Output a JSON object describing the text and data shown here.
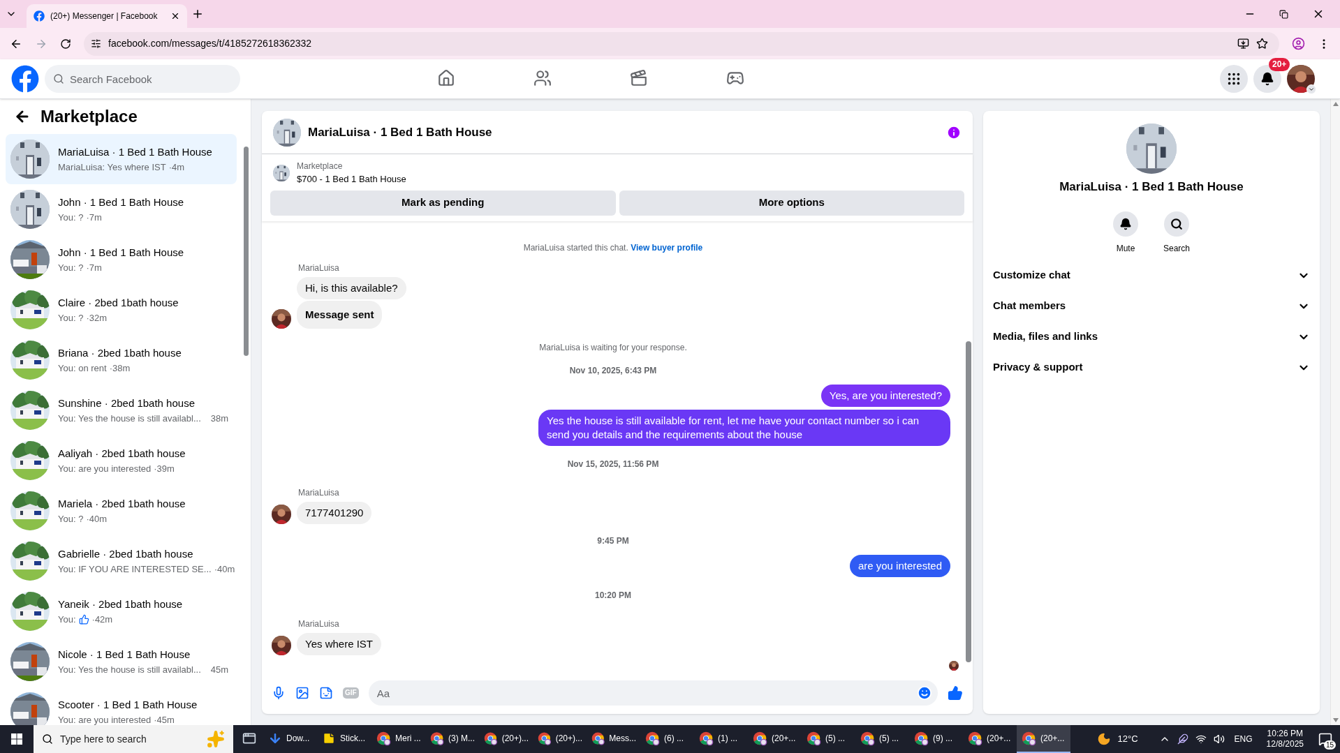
{
  "browser": {
    "tab_title": "(20+) Messenger | Facebook",
    "url": "facebook.com/messages/t/4185272618362332"
  },
  "header": {
    "search_placeholder": "Search Facebook",
    "nav": [
      {
        "kind": "home",
        "selected": false
      },
      {
        "kind": "friends",
        "selected": false
      },
      {
        "kind": "video",
        "selected": false
      },
      {
        "kind": "gaming",
        "selected": false
      }
    ],
    "notification_badge": "20+"
  },
  "sidebar": {
    "title": "Marketplace",
    "conversations": [
      {
        "title": "MariaLuisa · 1 Bed 1 Bath House",
        "kind": "text",
        "preview": "MariaLuisa: Yes where IST",
        "time": "·4m",
        "selected": true
      },
      {
        "title": "John · 1 Bed 1 Bath House",
        "kind": "text",
        "preview": "You: ?",
        "time": "·7m",
        "selected": false
      },
      {
        "title": "John · 1 Bed 1 Bath House",
        "kind": "text",
        "preview": "You: ?",
        "time": "·7m",
        "selected": false
      },
      {
        "title": "Claire · 2bed 1bath house",
        "kind": "text",
        "preview": "You: ?",
        "time": "·32m",
        "selected": false
      },
      {
        "title": "Briana · 2bed 1bath house",
        "kind": "text",
        "preview": "You: on rent",
        "time": "·38m",
        "selected": false
      },
      {
        "title": "Sunshine · 2bed 1bath house",
        "kind": "text",
        "preview": "You: Yes the house is still availabl...",
        "time": "38m",
        "selected": false
      },
      {
        "title": "Aaliyah · 2bed 1bath house",
        "kind": "text",
        "preview": "You: are you interested",
        "time": "·39m",
        "selected": false
      },
      {
        "title": "Mariela · 2bed 1bath house",
        "kind": "text",
        "preview": "You: ?",
        "time": "·40m",
        "selected": false
      },
      {
        "title": "Gabrielle · 2bed 1bath house",
        "kind": "text",
        "preview": "You: IF YOU ARE INTERESTED SE...",
        "time": "·40m",
        "selected": false
      },
      {
        "title": "Yaneik · 2bed 1bath house",
        "kind": "like",
        "preview": "You:",
        "time": "·42m",
        "selected": false
      },
      {
        "title": "Nicole · 1 Bed 1 Bath House",
        "kind": "text",
        "preview": "You: Yes the house is still availabl...",
        "time": "45m",
        "selected": false
      },
      {
        "title": "Scooter · 1 Bed 1 Bath House",
        "kind": "text",
        "preview": "You: are you interested",
        "time": "·45m",
        "selected": false
      }
    ]
  },
  "chat": {
    "title": "MariaLuisa · 1 Bed 1 Bath House",
    "listing": {
      "label": "Marketplace",
      "price_title": "$700 - 1 Bed 1 Bath House"
    },
    "actions": [
      "Mark as pending",
      "More options"
    ],
    "messages": [
      {
        "kind": "system",
        "text": "MariaLuisa started this chat.",
        "link": "View buyer profile"
      },
      {
        "kind": "sender",
        "text": "MariaLuisa"
      },
      {
        "kind": "incoming",
        "text": "Hi, is this available?",
        "avatar": false,
        "bold": false
      },
      {
        "kind": "incoming",
        "text": "Message sent",
        "avatar": true,
        "bold": true
      },
      {
        "kind": "notice",
        "text": "MariaLuisa is waiting for your response."
      },
      {
        "kind": "timestamp",
        "text": "Nov 10, 2025, 6:43 PM"
      },
      {
        "kind": "outgoing",
        "text": "Yes, are you interested?",
        "color": "#7a34f6"
      },
      {
        "kind": "outgoing",
        "text": "Yes the house is still available for rent, let me have your contact number so i can send you details and the requirements about the house",
        "color": "#6a38f5"
      },
      {
        "kind": "timestamp",
        "text": "Nov 15, 2025, 11:56 PM"
      },
      {
        "kind": "sender",
        "text": "MariaLuisa"
      },
      {
        "kind": "incoming",
        "text": "7177401290",
        "avatar": true,
        "bold": false
      },
      {
        "kind": "timestamp",
        "text": "9:45 PM"
      },
      {
        "kind": "outgoing",
        "text": "are you interested",
        "color": "#2f5bf4"
      },
      {
        "kind": "timestamp",
        "text": "10:20 PM"
      },
      {
        "kind": "sender",
        "text": "MariaLuisa"
      },
      {
        "kind": "incoming",
        "text": "Yes where IST",
        "avatar": true,
        "bold": false
      },
      {
        "kind": "read_receipt"
      }
    ],
    "composer": {
      "gif_label": "GIF",
      "placeholder": "Aa"
    }
  },
  "details": {
    "title": "MariaLuisa · 1 Bed 1 Bath House",
    "actions": [
      {
        "kind": "mute",
        "label": "Mute"
      },
      {
        "kind": "search",
        "label": "Search"
      }
    ],
    "sections": [
      {
        "label": "Customize chat",
        "expanded": false
      },
      {
        "label": "Chat members",
        "expanded": false
      },
      {
        "label": "Media, files and links",
        "expanded": false
      },
      {
        "label": "Privacy & support",
        "expanded": false
      }
    ]
  },
  "taskbar": {
    "search_placeholder": "Type here to search",
    "apps": [
      {
        "kind": "window",
        "selected": false
      },
      {
        "kind": "download",
        "label": "Dow...",
        "selected": false
      },
      {
        "kind": "note",
        "label": "Stick...",
        "selected": false
      },
      {
        "kind": "browser",
        "label": "Meri ...",
        "selected": false
      },
      {
        "kind": "browser",
        "label": "(3) M...",
        "selected": false
      },
      {
        "kind": "browser",
        "label": "(20+)...",
        "selected": false
      },
      {
        "kind": "browser",
        "label": "(20+)...",
        "selected": false
      },
      {
        "kind": "browser",
        "label": "Mess...",
        "selected": false
      },
      {
        "kind": "browser",
        "label": "(6) ...",
        "selected": false
      },
      {
        "kind": "browser",
        "label": "(1) ...",
        "selected": false
      },
      {
        "kind": "browser",
        "label": "(20+...",
        "selected": false
      },
      {
        "kind": "browser",
        "label": "(5) ...",
        "selected": false
      },
      {
        "kind": "browser",
        "label": "(5) ...",
        "selected": false
      },
      {
        "kind": "browser",
        "label": "(9) ...",
        "selected": false
      },
      {
        "kind": "browser",
        "label": "(20+...",
        "selected": false
      },
      {
        "kind": "browser",
        "label": "(20+...",
        "selected": true
      }
    ],
    "weather": "12°C",
    "language": "ENG",
    "time": "10:26 PM",
    "date": "12/8/2025",
    "notifications": "15"
  }
}
